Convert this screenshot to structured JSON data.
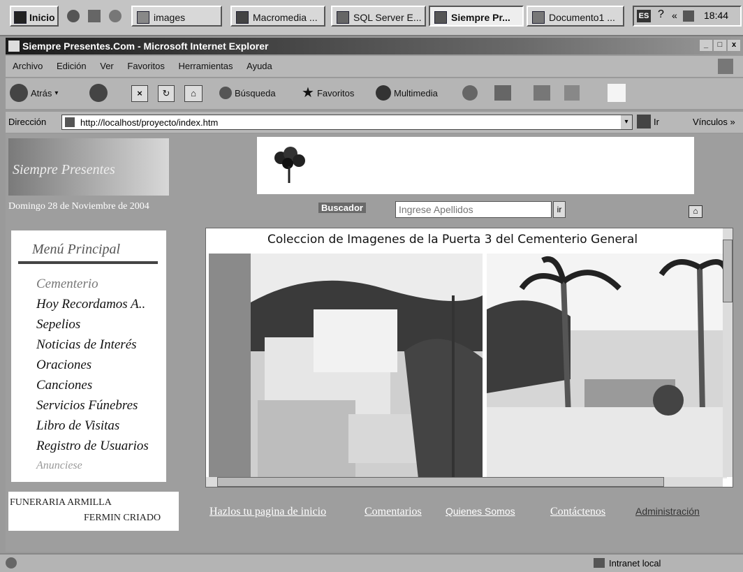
{
  "taskbar": {
    "start": "Inicio",
    "buttons": [
      "images",
      "Macromedia ...",
      "SQL Server E...",
      "Siempre Pr...",
      "Documento1 ..."
    ],
    "clock": "18:44",
    "lang": "ES"
  },
  "window": {
    "title": "Siempre Presentes.Com - Microsoft Internet Explorer",
    "controls": [
      "_",
      "□",
      "x"
    ]
  },
  "menu": [
    "Archivo",
    "Edición",
    "Ver",
    "Favoritos",
    "Herramientas",
    "Ayuda"
  ],
  "toolbar": {
    "back": "Atrás",
    "search": "Búsqueda",
    "favorites": "Favoritos",
    "media": "Multimedia"
  },
  "address": {
    "label": "Dirección",
    "url": "http://localhost/proyecto/index.htm",
    "go": "Ir",
    "links": "Vínculos »"
  },
  "page": {
    "logo_text": "Siempre Presentes",
    "date": "Domingo 28 de Noviembre de 2004",
    "search_label": "Buscador",
    "search_placeholder": "Ingrese Apellidos",
    "search_go": "ir",
    "menu_title": "Menú Principal",
    "menu_items": [
      "Cementerio",
      "Hoy Recordamos A..",
      "Sepelios",
      "Noticias de Interés",
      "Oraciones",
      "Canciones",
      "Servicios Fúnebres",
      "Libro de Visitas",
      "Registro de Usuarios",
      "Anunciese"
    ],
    "gallery_title": "Coleccion de Imagenes de la Puerta 3 del Cementerio General",
    "sponsor_line1": "FUNERARIA ARMILLA",
    "sponsor_line2": "FERMIN CRIADO",
    "footer_links": [
      "Hazlos tu pagina de inicio",
      "Comentarios",
      "Quienes Somos",
      "Contáctenos",
      "Administración"
    ]
  },
  "status": {
    "zone": "Intranet local"
  }
}
